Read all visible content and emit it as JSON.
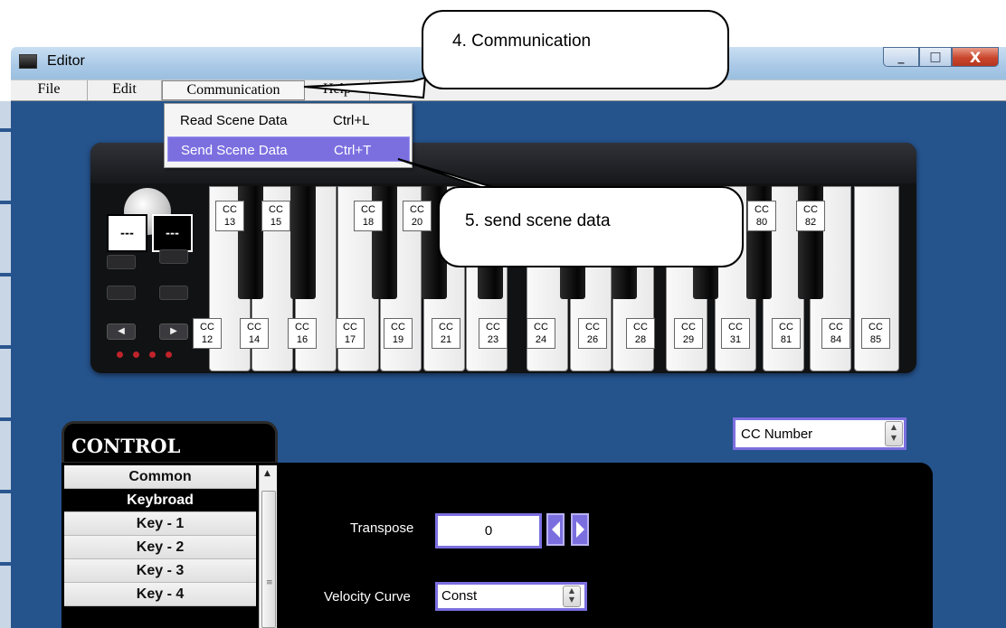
{
  "window": {
    "title": "Editor",
    "controls": {
      "minimize": "_",
      "maximize": "□",
      "close": "X"
    }
  },
  "menubar": {
    "items": [
      {
        "label": "File"
      },
      {
        "label": "Edit"
      },
      {
        "label": "Communication"
      },
      {
        "label": "Help"
      }
    ]
  },
  "dropdown": {
    "items": [
      {
        "label": "Read Scene Data",
        "shortcut": "Ctrl+L",
        "highlighted": false
      },
      {
        "label": "Send Scene Data",
        "shortcut": "Ctrl+T",
        "highlighted": true
      }
    ]
  },
  "callouts": {
    "communication": "4. Communication",
    "send": "5. send scene data"
  },
  "keyboard": {
    "display_left": "---",
    "display_right": "---",
    "black_cc": [
      "13",
      "15",
      "18",
      "20",
      "80",
      "82"
    ],
    "white_cc": [
      "12",
      "14",
      "16",
      "17",
      "19",
      "21",
      "23",
      "24",
      "26",
      "28",
      "29",
      "31",
      "81",
      "84",
      "85"
    ],
    "cc_prefix": "CC"
  },
  "control": {
    "title": "CONTROL",
    "list": [
      "Common",
      "Keybroad",
      "Key - 1",
      "Key - 2",
      "Key - 3",
      "Key - 4"
    ],
    "selected": "Keybroad"
  },
  "mode_select": {
    "value": "CC Number"
  },
  "panel": {
    "transpose_label": "Transpose",
    "transpose_value": "0",
    "velocity_label": "Velocity Curve",
    "velocity_value": "Const"
  },
  "colors": {
    "background": "#25538c",
    "accent": "#7b6fe0"
  }
}
